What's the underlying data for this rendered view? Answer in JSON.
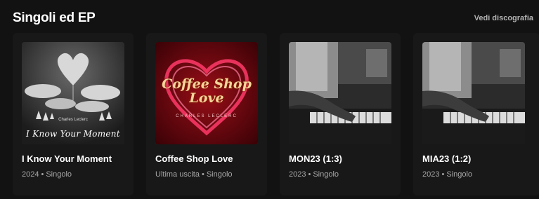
{
  "section": {
    "title": "Singoli ed EP",
    "see_all": "Vedi discografia"
  },
  "cards": [
    {
      "title": "I Know Your Moment",
      "year": "2024",
      "type": "Singolo",
      "cover_text": "I Know Your Moment",
      "cover_artist": "Charles Leclerc"
    },
    {
      "title": "Coffee Shop Love",
      "year": "Ultima uscita",
      "type": "Singolo",
      "cover_text": "Coffee Shop Love",
      "cover_artist": "CHARLES LECLERC"
    },
    {
      "title": "MON23 (1:3)",
      "year": "2023",
      "type": "Singolo"
    },
    {
      "title": "MIA23 (1:2)",
      "year": "2023",
      "type": "Singolo"
    }
  ],
  "separator": "•",
  "colors": {
    "background": "#121212",
    "card": "#181818",
    "meta_text": "#a7a7a7"
  }
}
